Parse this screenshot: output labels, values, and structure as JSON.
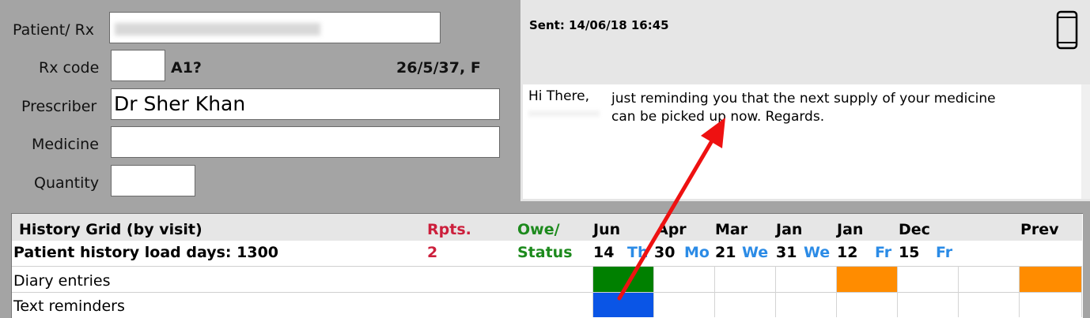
{
  "form": {
    "patient_label": "Patient/ Rx",
    "patient_value": "",
    "rxcode_label": "Rx code",
    "rxcode_value": "",
    "rxcode_extra": "A1?",
    "dob_sex": "26/5/37, F",
    "prescriber_label": "Prescriber",
    "prescriber_value": "Dr Sher Khan",
    "medicine_label": "Medicine",
    "medicine_value": "",
    "quantity_label": "Quantity",
    "quantity_value": ""
  },
  "message": {
    "sent": "Sent: 14/06/18 16:45",
    "greeting": "Hi There,",
    "line1": "just reminding you that the next supply of your medicine",
    "line2": "can be picked up now. Regards."
  },
  "grid": {
    "title": "History Grid (by visit)",
    "load_days": "Patient history load days: 1300",
    "rpts_label": "Rpts.",
    "rpts_value": "2",
    "owe_label": "Owe/",
    "status_label": "Status",
    "prev_label": "Prev",
    "columns": [
      {
        "month": "Jun",
        "day": "14",
        "weekday": "Th"
      },
      {
        "month": "Apr",
        "day": "30",
        "weekday": "Mo"
      },
      {
        "month": "Mar",
        "day": "21",
        "weekday": "We"
      },
      {
        "month": "Jan",
        "day": "31",
        "weekday": "We"
      },
      {
        "month": "Jan",
        "day": "12",
        "weekday": "Fr"
      },
      {
        "month": "Dec",
        "day": "15",
        "weekday": "Fr"
      }
    ],
    "rows": [
      {
        "label": "Diary entries"
      },
      {
        "label": "Text reminders"
      }
    ]
  },
  "colors": {
    "rpts": "#cc1f3c",
    "owe": "#1d8a1d",
    "weekday": "#2b8be6",
    "green_cell": "#008000",
    "orange_cell": "#ff8c00",
    "blue_cell": "#0a55e6",
    "arrow": "#ee1111"
  },
  "icons": {
    "device": "mobile-phone-icon"
  }
}
